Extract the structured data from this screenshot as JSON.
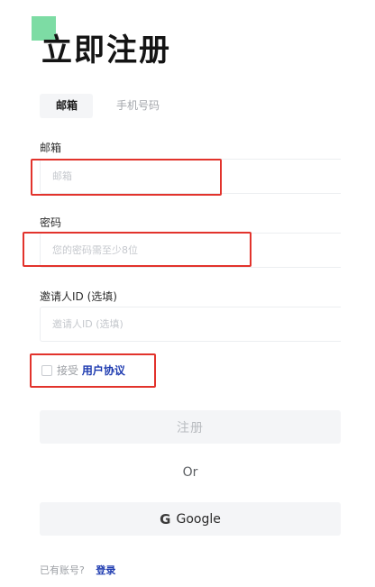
{
  "page": {
    "title": "立即注册"
  },
  "tabs": [
    {
      "label": "邮箱",
      "active": true
    },
    {
      "label": "手机号码",
      "active": false
    }
  ],
  "form": {
    "email": {
      "label": "邮箱",
      "placeholder": "邮箱",
      "value": ""
    },
    "password": {
      "label": "密码",
      "placeholder": "您的密码需至少8位",
      "value": ""
    },
    "invite": {
      "label": "邀请人ID (选填)",
      "placeholder": "邀请人ID (选填)",
      "value": ""
    }
  },
  "agreement": {
    "prefix": "接受",
    "link": "用户协议",
    "checked": false
  },
  "buttons": {
    "register": "注册",
    "or": "Or",
    "google_letter": "G",
    "google": "Google"
  },
  "footer": {
    "prompt": "已有账号?",
    "login": "登录"
  },
  "colors": {
    "accent": "#7ddca4",
    "link": "#1e3bb0",
    "highlight": "#e2332c"
  }
}
